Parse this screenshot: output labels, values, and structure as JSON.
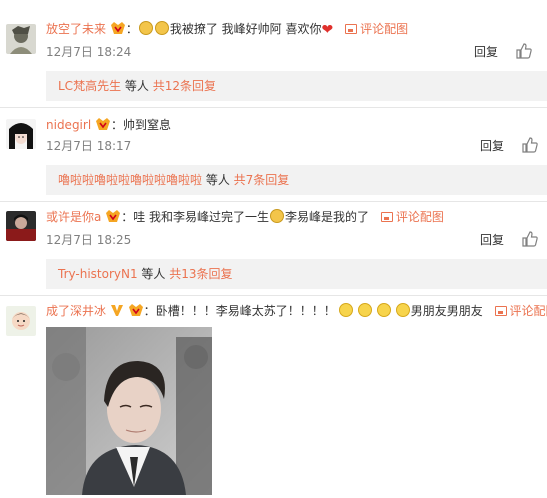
{
  "comments": [
    {
      "username": "放空了未来",
      "text": "我被撩了 我峰好帅阿 喜欢你",
      "pic_link": "评论配图",
      "time": "12月7日 18:24",
      "reply": "回复",
      "sub": {
        "user": "LC梵高先生",
        "mid": " 等人 ",
        "more": "共12条回复"
      }
    },
    {
      "username": "nidegirl",
      "text": "帅到窒息",
      "time": "12月7日 18:17",
      "reply": "回复",
      "sub": {
        "user": "嚕啦啦嚕啦啦嚕啦啦嚕啦啦",
        "mid": " 等人 ",
        "more": "共7条回复"
      }
    },
    {
      "username": "或许是你a",
      "text_a": "哇 我和李易峰过完了一生",
      "text_b": "李易峰是我的了",
      "pic_link": "评论配图",
      "time": "12月7日 18:25",
      "reply": "回复",
      "sub": {
        "user": "Try-historyN1",
        "mid": " 等人 ",
        "more": "共13条回复"
      }
    },
    {
      "username": "成了深井冰",
      "text_a": "卧槽！！！李易峰太苏了！！！！",
      "text_b": "男朋友男朋友",
      "pic_link": "评论配图"
    }
  ],
  "icons": {
    "like": "thumb-up-icon",
    "picture": "picture-icon",
    "verified": "vip-badge-icon"
  },
  "colors": {
    "username": "#eb7350",
    "time": "#808080",
    "subbox_bg": "#f2f2f2"
  }
}
